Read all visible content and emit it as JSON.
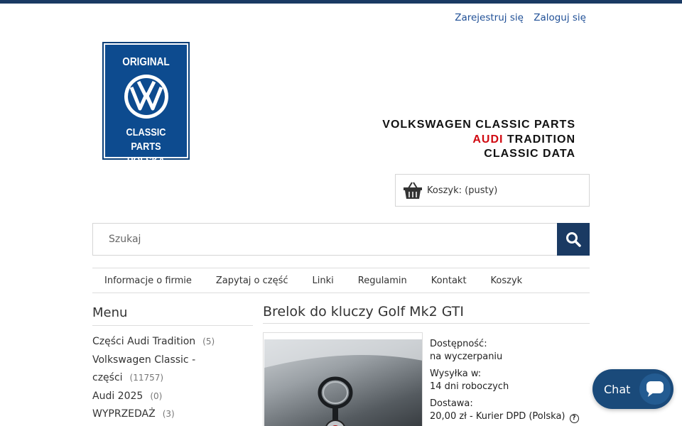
{
  "auth": {
    "register": "Zarejestruj się",
    "login": "Zaloguj się"
  },
  "logo": {
    "line1": "ORIGINAL",
    "line2": "CLASSIC PARTS",
    "line3": "POLSKA"
  },
  "brand": {
    "line1": "VOLKSWAGEN CLASSIC PARTS",
    "line2_red": "AUDI",
    "line2_rest": " TRADITION",
    "line3": "CLASSIC DATA"
  },
  "cart": {
    "label": "Koszyk: (pusty)"
  },
  "search": {
    "placeholder": "Szukaj"
  },
  "nav": [
    "Informacje o firmie",
    "Zapytaj o część",
    "Linki",
    "Regulamin",
    "Kontakt",
    "Koszyk"
  ],
  "menu": {
    "title": "Menu",
    "items": [
      {
        "label": "Części Audi Tradition",
        "count": "(5)"
      },
      {
        "label": "Volkswagen Classic - części",
        "count": "(11757)"
      },
      {
        "label": "Audi 2025",
        "count": "(0)"
      },
      {
        "label": "WYPRZEDAŻ",
        "count": "(3)"
      }
    ]
  },
  "product": {
    "title": "Brelok do kluczy Golf Mk2 GTI",
    "availability_label": "Dostępność:",
    "availability_value": "na wyczerpaniu",
    "shipping_label": "Wysyłka w:",
    "shipping_value": "14 dni roboczych",
    "delivery_label": "Dostawa:",
    "delivery_value": "20,00 zł - Kurier DPD (Polska)"
  },
  "chat": {
    "label": "Chat"
  },
  "colors": {
    "primary": "#1a3a63",
    "link": "#1f4f96",
    "brand_red": "#d10a11"
  }
}
